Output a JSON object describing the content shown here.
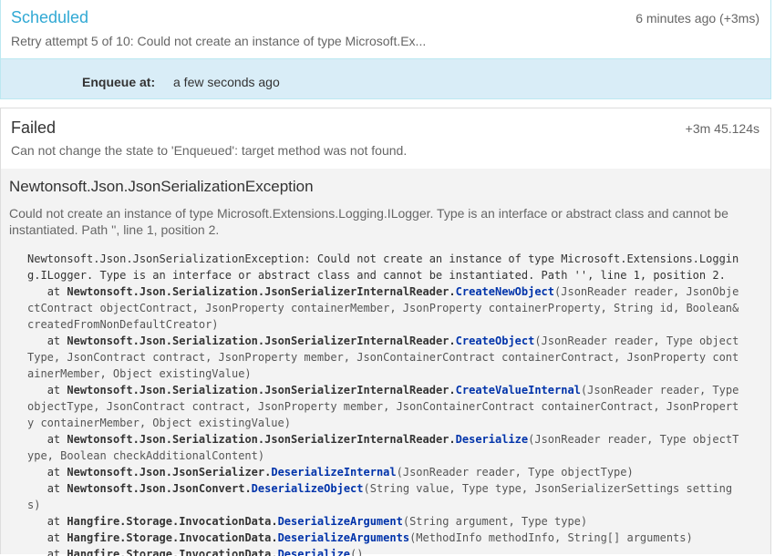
{
  "scheduled": {
    "title": "Scheduled",
    "time": "6 minutes ago (+3ms)",
    "reason": "Retry attempt 5 of 10: Could not create an instance of type Microsoft.Ex...",
    "enqueue_label": "Enqueue at:",
    "enqueue_value": "a few seconds ago"
  },
  "failed": {
    "title": "Failed",
    "time": "+3m 45.124s",
    "reason": "Can not change the state to 'Enqueued': target method was not found.",
    "exception_type": "Newtonsoft.Json.JsonSerializationException",
    "exception_message": "Could not create an instance of type Microsoft.Extensions.Logging.ILogger. Type is an interface or abstract class and cannot be instantiated. Path '', line 1, position 2.",
    "stack_header": "Newtonsoft.Json.JsonSerializationException: Could not create an instance of type Microsoft.Extensions.Logging.ILogger. Type is an interface or abstract class and cannot be instantiated. Path '', line 1, position 2.",
    "frames": [
      {
        "prefix": "   at ",
        "cls": "Newtonsoft.Json.Serialization.JsonSerializerInternalReader.",
        "method": "CreateNewObject",
        "args": "(JsonReader reader, JsonObjectContract objectContract, JsonProperty containerMember, JsonProperty containerProperty, String id, Boolean& createdFromNonDefaultCreator)"
      },
      {
        "prefix": "   at ",
        "cls": "Newtonsoft.Json.Serialization.JsonSerializerInternalReader.",
        "method": "CreateObject",
        "args": "(JsonReader reader, Type objectType, JsonContract contract, JsonProperty member, JsonContainerContract containerContract, JsonProperty containerMember, Object existingValue)"
      },
      {
        "prefix": "   at ",
        "cls": "Newtonsoft.Json.Serialization.JsonSerializerInternalReader.",
        "method": "CreateValueInternal",
        "args": "(JsonReader reader, Type objectType, JsonContract contract, JsonProperty member, JsonContainerContract containerContract, JsonProperty containerMember, Object existingValue)"
      },
      {
        "prefix": "   at ",
        "cls": "Newtonsoft.Json.Serialization.JsonSerializerInternalReader.",
        "method": "Deserialize",
        "args": "(JsonReader reader, Type objectType, Boolean checkAdditionalContent)"
      },
      {
        "prefix": "   at ",
        "cls": "Newtonsoft.Json.JsonSerializer.",
        "method": "DeserializeInternal",
        "args": "(JsonReader reader, Type objectType)"
      },
      {
        "prefix": "   at ",
        "cls": "Newtonsoft.Json.JsonConvert.",
        "method": "DeserializeObject",
        "args": "(String value, Type type, JsonSerializerSettings settings)"
      },
      {
        "prefix": "   at ",
        "cls": "Hangfire.Storage.InvocationData.",
        "method": "DeserializeArgument",
        "args": "(String argument, Type type)"
      },
      {
        "prefix": "   at ",
        "cls": "Hangfire.Storage.InvocationData.",
        "method": "DeserializeArguments",
        "args": "(MethodInfo methodInfo, String[] arguments)"
      },
      {
        "prefix": "   at ",
        "cls": "Hangfire.Storage.InvocationData.",
        "method": "Deserialize",
        "args": "()"
      }
    ]
  },
  "colors": {
    "scheduled_title": "#31a9d4",
    "scheduled_body_bg": "#d9edf7",
    "failed_body_bg": "#f3f3f3",
    "method_link": "#0033aa"
  }
}
